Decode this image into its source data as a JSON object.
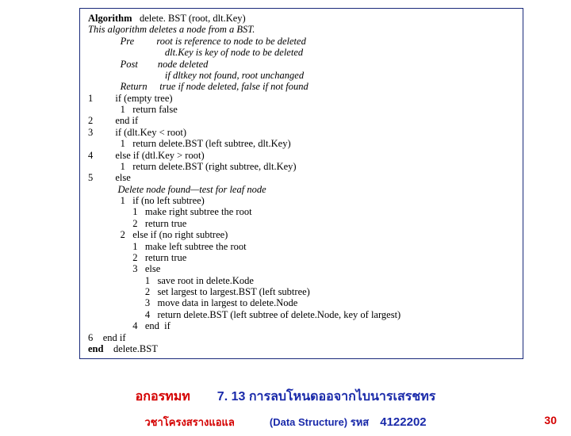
{
  "algorithm": {
    "heading_bold": "Algorithm",
    "heading_rest": "   delete. BST (root, dlt.Key)",
    "desc": "This algorithm deletes a node from a BST.",
    "pre_label": "             Pre         ",
    "pre1": "root is reference to node to be deleted",
    "pre2": "                               dlt.Key is key of node to be deleted",
    "post_label": "             Post        ",
    "post1": "node deleted",
    "post2": "                               if dltkey not found, root unchanged",
    "return_label": "             Return     ",
    "return1": "true if node deleted, false if not found",
    "l1": "1         if (empty tree)",
    "l1a": "             1   return false",
    "l2": "2         end if",
    "l3": "3         if (dlt.Key < root)",
    "l3a": "             1   return delete.BST (left subtree, dlt.Key)",
    "l4": "4         else if (dtl.Key > root)",
    "l4a": "             1   return delete.BST (right subtree, dlt.Key)",
    "l5": "5         else",
    "l5a": "            Delete node found—test for leaf node",
    "l5b": "             1   if (no left subtree)",
    "l5c": "                  1   make right subtree the root",
    "l5d": "                  2   return true",
    "l5e": "             2   else if (no right subtree)",
    "l5f": "                  1   make left subtree the root",
    "l5g": "                  2   return true",
    "l5h": "                  3   else",
    "l5i": "                       1   save root in delete.Kode",
    "l5j": "                       2   set largest to largest.BST (left subtree)",
    "l5k": "                       3   move data in largest to delete.Node",
    "l5l": "                       4   return delete.BST (left subtree of delete.Node, key of largest)",
    "l5m": "                  4   end  if",
    "l6": "6    end if",
    "end_bold": "end",
    "end_rest": "    delete.BST"
  },
  "footer": {
    "algo_label": "อกอรทมท",
    "title_right": "7. 13 การลบโหนดออจากไบนารเสรชทร",
    "subject": "วชาโครงสรางแอแล",
    "ds": "(Data Structure) รหส",
    "code": "4122202",
    "page": "30"
  }
}
